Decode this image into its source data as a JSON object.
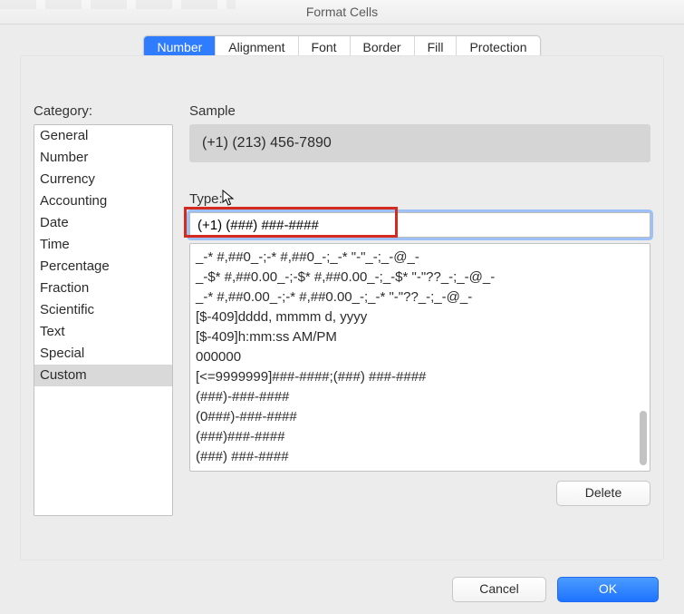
{
  "window": {
    "title": "Format Cells"
  },
  "tabs": {
    "items": [
      {
        "label": "Number",
        "active": true
      },
      {
        "label": "Alignment",
        "active": false
      },
      {
        "label": "Font",
        "active": false
      },
      {
        "label": "Border",
        "active": false
      },
      {
        "label": "Fill",
        "active": false
      },
      {
        "label": "Protection",
        "active": false
      }
    ]
  },
  "category": {
    "label": "Category:",
    "items": [
      {
        "label": "General",
        "selected": false
      },
      {
        "label": "Number",
        "selected": false
      },
      {
        "label": "Currency",
        "selected": false
      },
      {
        "label": "Accounting",
        "selected": false
      },
      {
        "label": "Date",
        "selected": false
      },
      {
        "label": "Time",
        "selected": false
      },
      {
        "label": "Percentage",
        "selected": false
      },
      {
        "label": "Fraction",
        "selected": false
      },
      {
        "label": "Scientific",
        "selected": false
      },
      {
        "label": "Text",
        "selected": false
      },
      {
        "label": "Special",
        "selected": false
      },
      {
        "label": "Custom",
        "selected": true
      }
    ]
  },
  "sample": {
    "label": "Sample",
    "value": "(+1) (213) 456-7890"
  },
  "type": {
    "label": "Type:",
    "value": "(+1) (###) ###-####"
  },
  "codes": {
    "items": [
      "_-* #,##0_-;-* #,##0_-;_-* \"-\"_-;_-@_-",
      "_-$* #,##0.00_-;-$* #,##0.00_-;_-$* \"-\"??_-;_-@_-",
      "_-* #,##0.00_-;-* #,##0.00_-;_-* \"-\"??_-;_-@_-",
      "[$-409]dddd, mmmm d, yyyy",
      "[$-409]h:mm:ss AM/PM",
      "000000",
      "[<=9999999]###-####;(###) ###-####",
      "(###)-###-####",
      "(0###)-###-####",
      "(###)###-####",
      "(###) ###-####"
    ]
  },
  "buttons": {
    "delete": "Delete",
    "cancel": "Cancel",
    "ok": "OK"
  }
}
